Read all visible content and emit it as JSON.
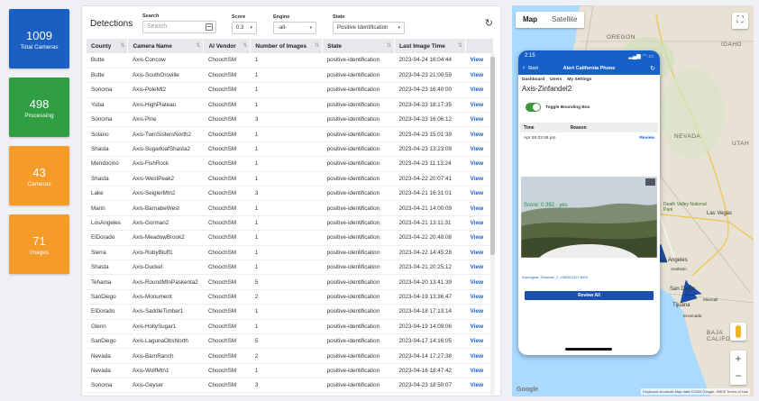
{
  "stats": [
    {
      "value": "1009",
      "label": "Total Cameras",
      "color": "#1b5fc2"
    },
    {
      "value": "498",
      "label": "Processing",
      "color": "#2f9e43"
    },
    {
      "value": "43",
      "label": "Cameras",
      "color": "#f49b2a"
    },
    {
      "value": "71",
      "label": "Images",
      "color": "#f49b2a"
    }
  ],
  "detections": {
    "title": "Detections",
    "filters": {
      "search_label": "Search",
      "search_placeholder": "Search",
      "score_label": "Score",
      "score_value": "0.3",
      "engine_label": "Engine",
      "engine_value": "-all-",
      "state_label": "State",
      "state_value": "Positive Identification"
    },
    "columns": [
      "County",
      "Camera Name",
      "AI Vendor",
      "Number of Images",
      "State",
      "Last Image Time",
      ""
    ],
    "view_label": "View",
    "rows": [
      [
        "Butte",
        "Axis-Concow",
        "ChoochSM",
        "1",
        "positive-identification",
        "2023-04-24 16:04:44"
      ],
      [
        "Butte",
        "Axis-SouthOroville",
        "ChoochSM",
        "1",
        "positive-identification",
        "2023-04-23 21:00:59"
      ],
      [
        "Sonoma",
        "Axis-PoleMt2",
        "ChoochSM",
        "1",
        "positive-identification",
        "2023-04-23 16:40:00"
      ],
      [
        "Yuba",
        "Axis-HighPlateau",
        "ChoochSM",
        "1",
        "positive-identification",
        "2023-04-23 18:17:35"
      ],
      [
        "Sonoma",
        "Axis-Pine",
        "ChoochSM",
        "3",
        "positive-identification",
        "2023-04-23 16:06:12"
      ],
      [
        "Solano",
        "Axis-TwinSistersNorth2",
        "ChoochSM",
        "1",
        "positive-identification",
        "2023-04-23 15:01:39"
      ],
      [
        "Shasta",
        "Axis-SugarloafShasta2",
        "ChoochSM",
        "1",
        "positive-identification",
        "2023-04-23 13:23:09"
      ],
      [
        "Mendocino",
        "Axis-FishRock",
        "ChoochSM",
        "1",
        "positive-identification",
        "2023-04-23 11:13:24"
      ],
      [
        "Shasta",
        "Axis-WestPeak2",
        "ChoochSM",
        "1",
        "positive-identification",
        "2023-04-22 20:07:41"
      ],
      [
        "Lake",
        "Axis-SeiglerMtn2",
        "ChoochSM",
        "3",
        "positive-identification",
        "2023-04-21 16:31:01"
      ],
      [
        "Marin",
        "Axis-BarnabeWest",
        "ChoochSM",
        "1",
        "positive-identification",
        "2023-04-21 14:00:09"
      ],
      [
        "LosAngeles",
        "Axis-Gorman2",
        "ChoochSM",
        "1",
        "positive-identification",
        "2023-04-21 13:11:31"
      ],
      [
        "ElDorado",
        "Axis-MeadowBrook2",
        "ChoochSM",
        "1",
        "positive-identification",
        "2023-04-22 20:48:08"
      ],
      [
        "Sierra",
        "Axis-RubyBluff1",
        "ChoochSM",
        "1",
        "positive-identification",
        "2023-04-22 14:45:28"
      ],
      [
        "Shasta",
        "Axis-Ducket",
        "ChoochSM",
        "1",
        "positive-identification",
        "2023-04-21 20:25:12"
      ],
      [
        "Tehama",
        "Axis-RoundMtnPaskenta2",
        "ChoochSM",
        "5",
        "positive-identification",
        "2023-04-20 13:41:39"
      ],
      [
        "SanDiego",
        "Axis-Monument",
        "ChoochSM",
        "2",
        "positive-identification",
        "2023-04-19 13:36:47"
      ],
      [
        "ElDorado",
        "Axis-SaddleTimber1",
        "ChoochSM",
        "1",
        "positive-identification",
        "2023-04-18 17:13:14"
      ],
      [
        "Glenn",
        "Axis-HollySugar1",
        "ChoochSM",
        "1",
        "positive-identification",
        "2023-04-19 14:09:06"
      ],
      [
        "SanDiego",
        "Axis-LagunaObsNorth",
        "ChoochSM",
        "5",
        "positive-identification",
        "2023-04-17 14:16:05"
      ],
      [
        "Nevada",
        "Axis-BarnRanch",
        "ChoochSM",
        "2",
        "positive-identification",
        "2023-04-14 17:27:38"
      ],
      [
        "Nevada",
        "Axis-WolfMtn1",
        "ChoochSM",
        "1",
        "positive-identification",
        "2023-04-16 18:47:42"
      ],
      [
        "Sonoma",
        "Axis-Geyser",
        "ChoochSM",
        "3",
        "positive-identification",
        "2023-04-23 18:50:07"
      ]
    ]
  },
  "map": {
    "map_label": "Map",
    "satellite_label": "Satellite",
    "labels": {
      "oregon": "OREGON",
      "idaho": "IDAHO",
      "nevada": "NEVADA",
      "utah": "UTAH",
      "baja": "BAJA CALIFORNIA",
      "las_vegas": "Las Vegas",
      "death_valley": "Death Valley National Park",
      "los_angeles": "Los Angeles",
      "anaheim": "Anaheim",
      "san_diego": "San Diego",
      "tijuana": "Tijuana",
      "mexicali": "Mexicali",
      "ensenada": "Ensenada"
    },
    "google": "Google",
    "attribution": "Keyboard shortcuts   Map data ©2023 Google, INEGI   Terms of Use"
  },
  "phone": {
    "time": "2:15",
    "signal": "▂▄▆ ◠ ▭",
    "back_label": "Start",
    "title": "Alert California Phone",
    "menu": [
      "Dashboard",
      "Users",
      "My Settings"
    ],
    "camera": "Axis-Zinfandel2",
    "toggle_label": "Toggle Bounding Box",
    "table_cols": [
      "Time",
      "Reason"
    ],
    "row_time": "Apr 26 03:48 pm",
    "row_action": "Review",
    "score": "Score: 0.392 - yes",
    "image_link": "Zoom/gear: Zinfandel_2_1682521327.8913",
    "review_all": "Review All"
  }
}
